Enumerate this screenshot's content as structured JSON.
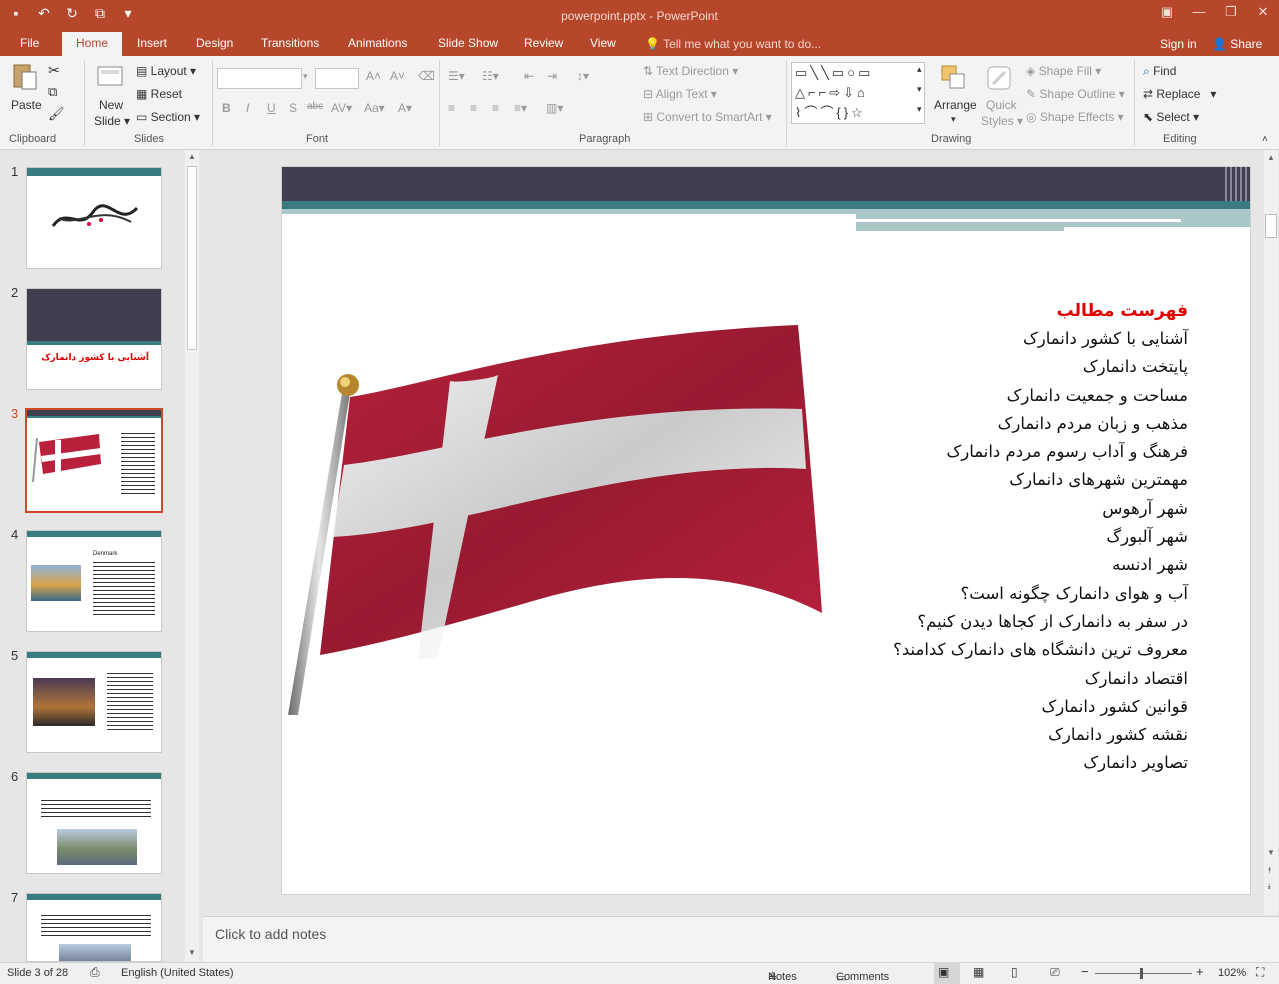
{
  "window": {
    "title": "powerpoint.pptx - PowerPoint"
  },
  "tabs": [
    {
      "label": "File"
    },
    {
      "label": "Home"
    },
    {
      "label": "Insert"
    },
    {
      "label": "Design"
    },
    {
      "label": "Transitions"
    },
    {
      "label": "Animations"
    },
    {
      "label": "Slide Show"
    },
    {
      "label": "Review"
    },
    {
      "label": "View"
    }
  ],
  "tellme": "Tell me what you want to do...",
  "account": {
    "signin": "Sign in",
    "share": "Share"
  },
  "ribbon": {
    "clipboard": {
      "label": "Clipboard",
      "paste": "Paste"
    },
    "slides": {
      "label": "Slides",
      "new_slide": "New",
      "new_slide2": "Slide",
      "layout": "Layout",
      "reset": "Reset",
      "section": "Section"
    },
    "font": {
      "label": "Font"
    },
    "paragraph": {
      "label": "Paragraph",
      "text_direction": "Text Direction",
      "align_text": "Align Text",
      "convert_smartart": "Convert to SmartArt"
    },
    "drawing": {
      "label": "Drawing",
      "arrange": "Arrange",
      "quick_styles": "Quick",
      "quick_styles2": "Styles",
      "shape_fill": "Shape Fill",
      "shape_outline": "Shape Outline",
      "shape_effects": "Shape Effects"
    },
    "editing": {
      "label": "Editing",
      "find": "Find",
      "replace": "Replace",
      "select": "Select"
    }
  },
  "thumbnails": [
    {
      "num": "1"
    },
    {
      "num": "2",
      "caption": "آشنایی با کشور دانمارک"
    },
    {
      "num": "3"
    },
    {
      "num": "4",
      "caption": "Denmark"
    },
    {
      "num": "5"
    },
    {
      "num": "6"
    },
    {
      "num": "7"
    }
  ],
  "slide": {
    "toc_title": "فهرست مطالب",
    "toc_items": [
      "آشنایی با کشور دانمارک",
      "پایتخت دانمارک",
      "مساحت و جمعیت دانمارک",
      "مذهب و زبان مردم دانمارک",
      "فرهنگ و آداب رسوم مردم دانمارک",
      "مهمترین شهرهای دانمارک",
      "شهر آرهوس",
      "شهر آلبورگ",
      "شهر ادنسه",
      "آب و هوای دانمارک چگونه است؟",
      "در سفر به دانمارک از کجاها دیدن کنیم؟",
      "معروف ترین دانشگاه های دانمارک کدامند؟",
      "اقتصاد دانمارک",
      "قوانین کشور دانمارک",
      "نقشه کشور دانمارک",
      "تصاویر دانمارک"
    ]
  },
  "notes": {
    "placeholder": "Click to add notes"
  },
  "status": {
    "slide": "Slide 3 of 28",
    "language": "English (United States)",
    "notes": "Notes",
    "comments": "Comments",
    "zoom": "102%"
  },
  "colors": {
    "accent": "#b7472a",
    "flag_red": "#b8203c",
    "header_bar": "#3f3f50",
    "teal": "#3a7b80"
  }
}
